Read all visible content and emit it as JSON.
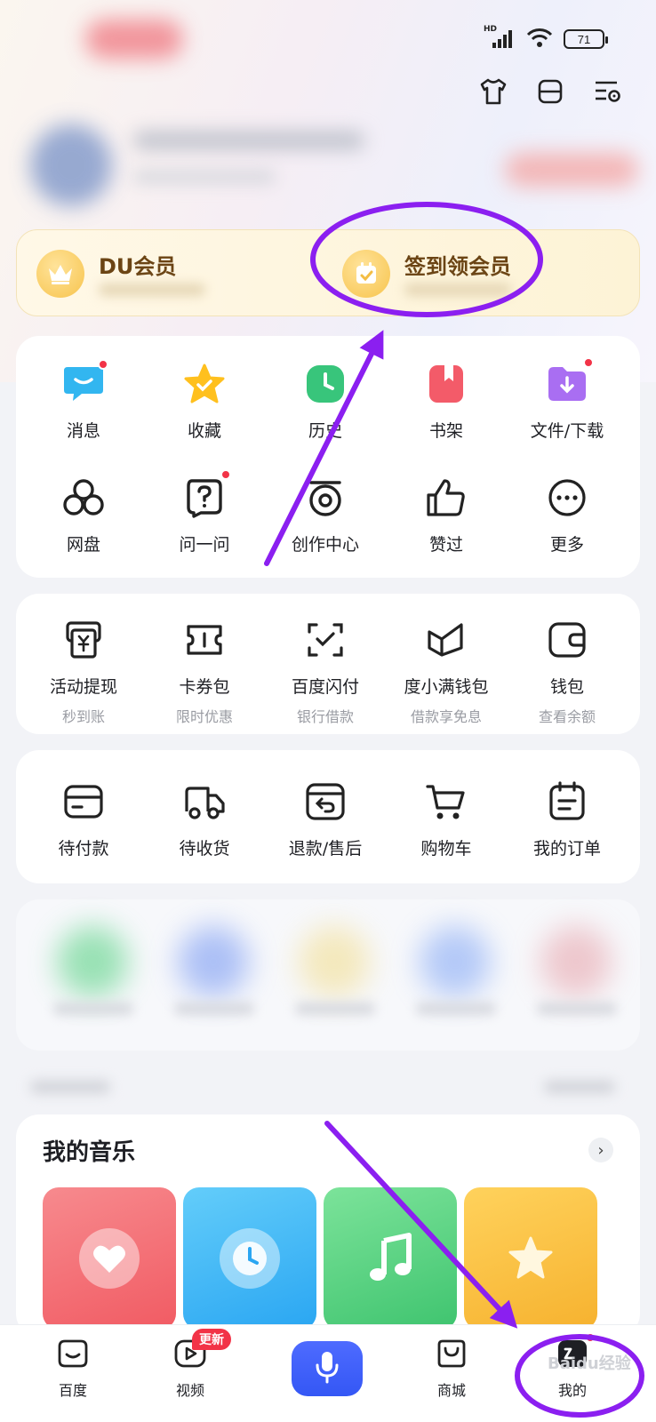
{
  "status_bar": {
    "network": "HD",
    "battery": "71"
  },
  "top_tools": [
    "tshirt-icon",
    "scan-icon",
    "settings-list-icon"
  ],
  "vip": {
    "left": {
      "title": "DU会员",
      "icon": "crown-icon"
    },
    "right": {
      "title": "签到领会员",
      "icon": "calendar-check-icon"
    }
  },
  "quick_grid": [
    {
      "label": "消息",
      "icon": "message-icon",
      "badge": true
    },
    {
      "label": "收藏",
      "icon": "star-icon",
      "badge": false
    },
    {
      "label": "历史",
      "icon": "clock-icon",
      "badge": false
    },
    {
      "label": "书架",
      "icon": "bookmark-icon",
      "badge": false
    },
    {
      "label": "文件/下载",
      "icon": "folder-download-icon",
      "badge": true
    },
    {
      "label": "网盘",
      "icon": "cloud-drive-icon",
      "badge": false
    },
    {
      "label": "问一问",
      "icon": "ask-icon",
      "badge": true
    },
    {
      "label": "创作中心",
      "icon": "create-center-icon",
      "badge": false
    },
    {
      "label": "赞过",
      "icon": "thumbs-up-icon",
      "badge": false
    },
    {
      "label": "更多",
      "icon": "more-icon",
      "badge": false
    }
  ],
  "finance": [
    {
      "label": "活动提现",
      "sub": "秒到账",
      "icon": "withdraw-icon"
    },
    {
      "label": "卡券包",
      "sub": "限时优惠",
      "icon": "coupon-icon"
    },
    {
      "label": "百度闪付",
      "sub": "银行借款",
      "icon": "scan-pay-icon"
    },
    {
      "label": "度小满钱包",
      "sub": "借款享免息",
      "icon": "duxiaoman-icon"
    },
    {
      "label": "钱包",
      "sub": "查看余额",
      "icon": "wallet-icon"
    }
  ],
  "orders": [
    {
      "label": "待付款",
      "icon": "card-icon"
    },
    {
      "label": "待收货",
      "icon": "truck-icon"
    },
    {
      "label": "退款/售后",
      "icon": "refund-icon"
    },
    {
      "label": "购物车",
      "icon": "cart-icon"
    },
    {
      "label": "我的订单",
      "icon": "order-list-icon"
    }
  ],
  "music": {
    "title": "我的音乐",
    "more": "›",
    "tiles": [
      {
        "icon": "heart-icon",
        "color": "#f36b71"
      },
      {
        "icon": "clock-icon",
        "color": "#3db4f5"
      },
      {
        "icon": "music-note-icon",
        "color": "#4fd07a"
      },
      {
        "icon": "star-icon",
        "color": "#f7be3c"
      }
    ]
  },
  "tabbar": [
    {
      "label": "百度",
      "icon": "baidu-home-icon"
    },
    {
      "label": "视频",
      "icon": "video-icon",
      "badge": "更新"
    },
    {
      "label": "",
      "icon": "microphone-icon"
    },
    {
      "label": "商城",
      "icon": "shop-bag-icon"
    },
    {
      "label": "我的",
      "icon": "profile-icon"
    }
  ],
  "watermark": "Baidu经验",
  "colors": {
    "annotation": "#8b1ff0",
    "badge_red": "#f23347",
    "voice_blue": "#3f60ff",
    "vip_text": "#6b4414"
  }
}
